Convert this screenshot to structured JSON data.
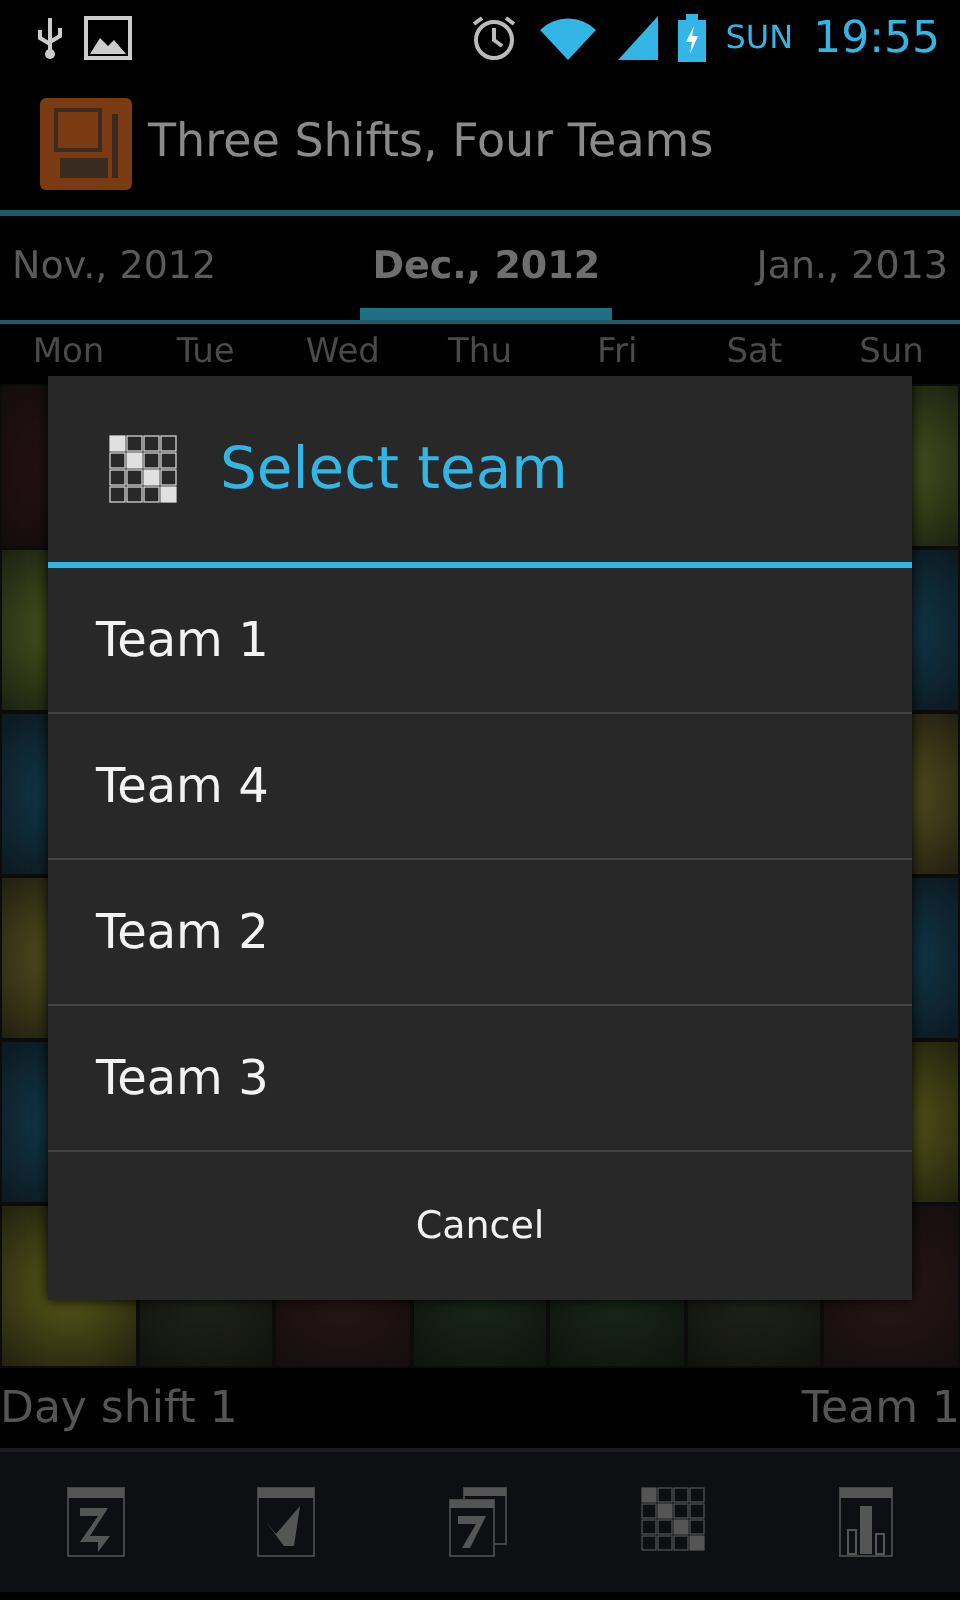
{
  "status_bar": {
    "day": "SUN",
    "time": "19:55"
  },
  "app_bar": {
    "title": "Three Shifts, Four Teams"
  },
  "month_tabs": [
    {
      "label": "Nov., 2012",
      "selected": false
    },
    {
      "label": "Dec., 2012",
      "selected": true
    },
    {
      "label": "Jan., 2013",
      "selected": false
    }
  ],
  "weekdays": [
    "Mon",
    "Tue",
    "Wed",
    "Thu",
    "Fri",
    "Sat",
    "Sun"
  ],
  "footer": {
    "shift": "Day shift 1",
    "team": "Team 1"
  },
  "dialog": {
    "title": "Select team",
    "options": [
      "Team 1",
      "Team 4",
      "Team 2",
      "Team 3"
    ],
    "cancel": "Cancel"
  }
}
